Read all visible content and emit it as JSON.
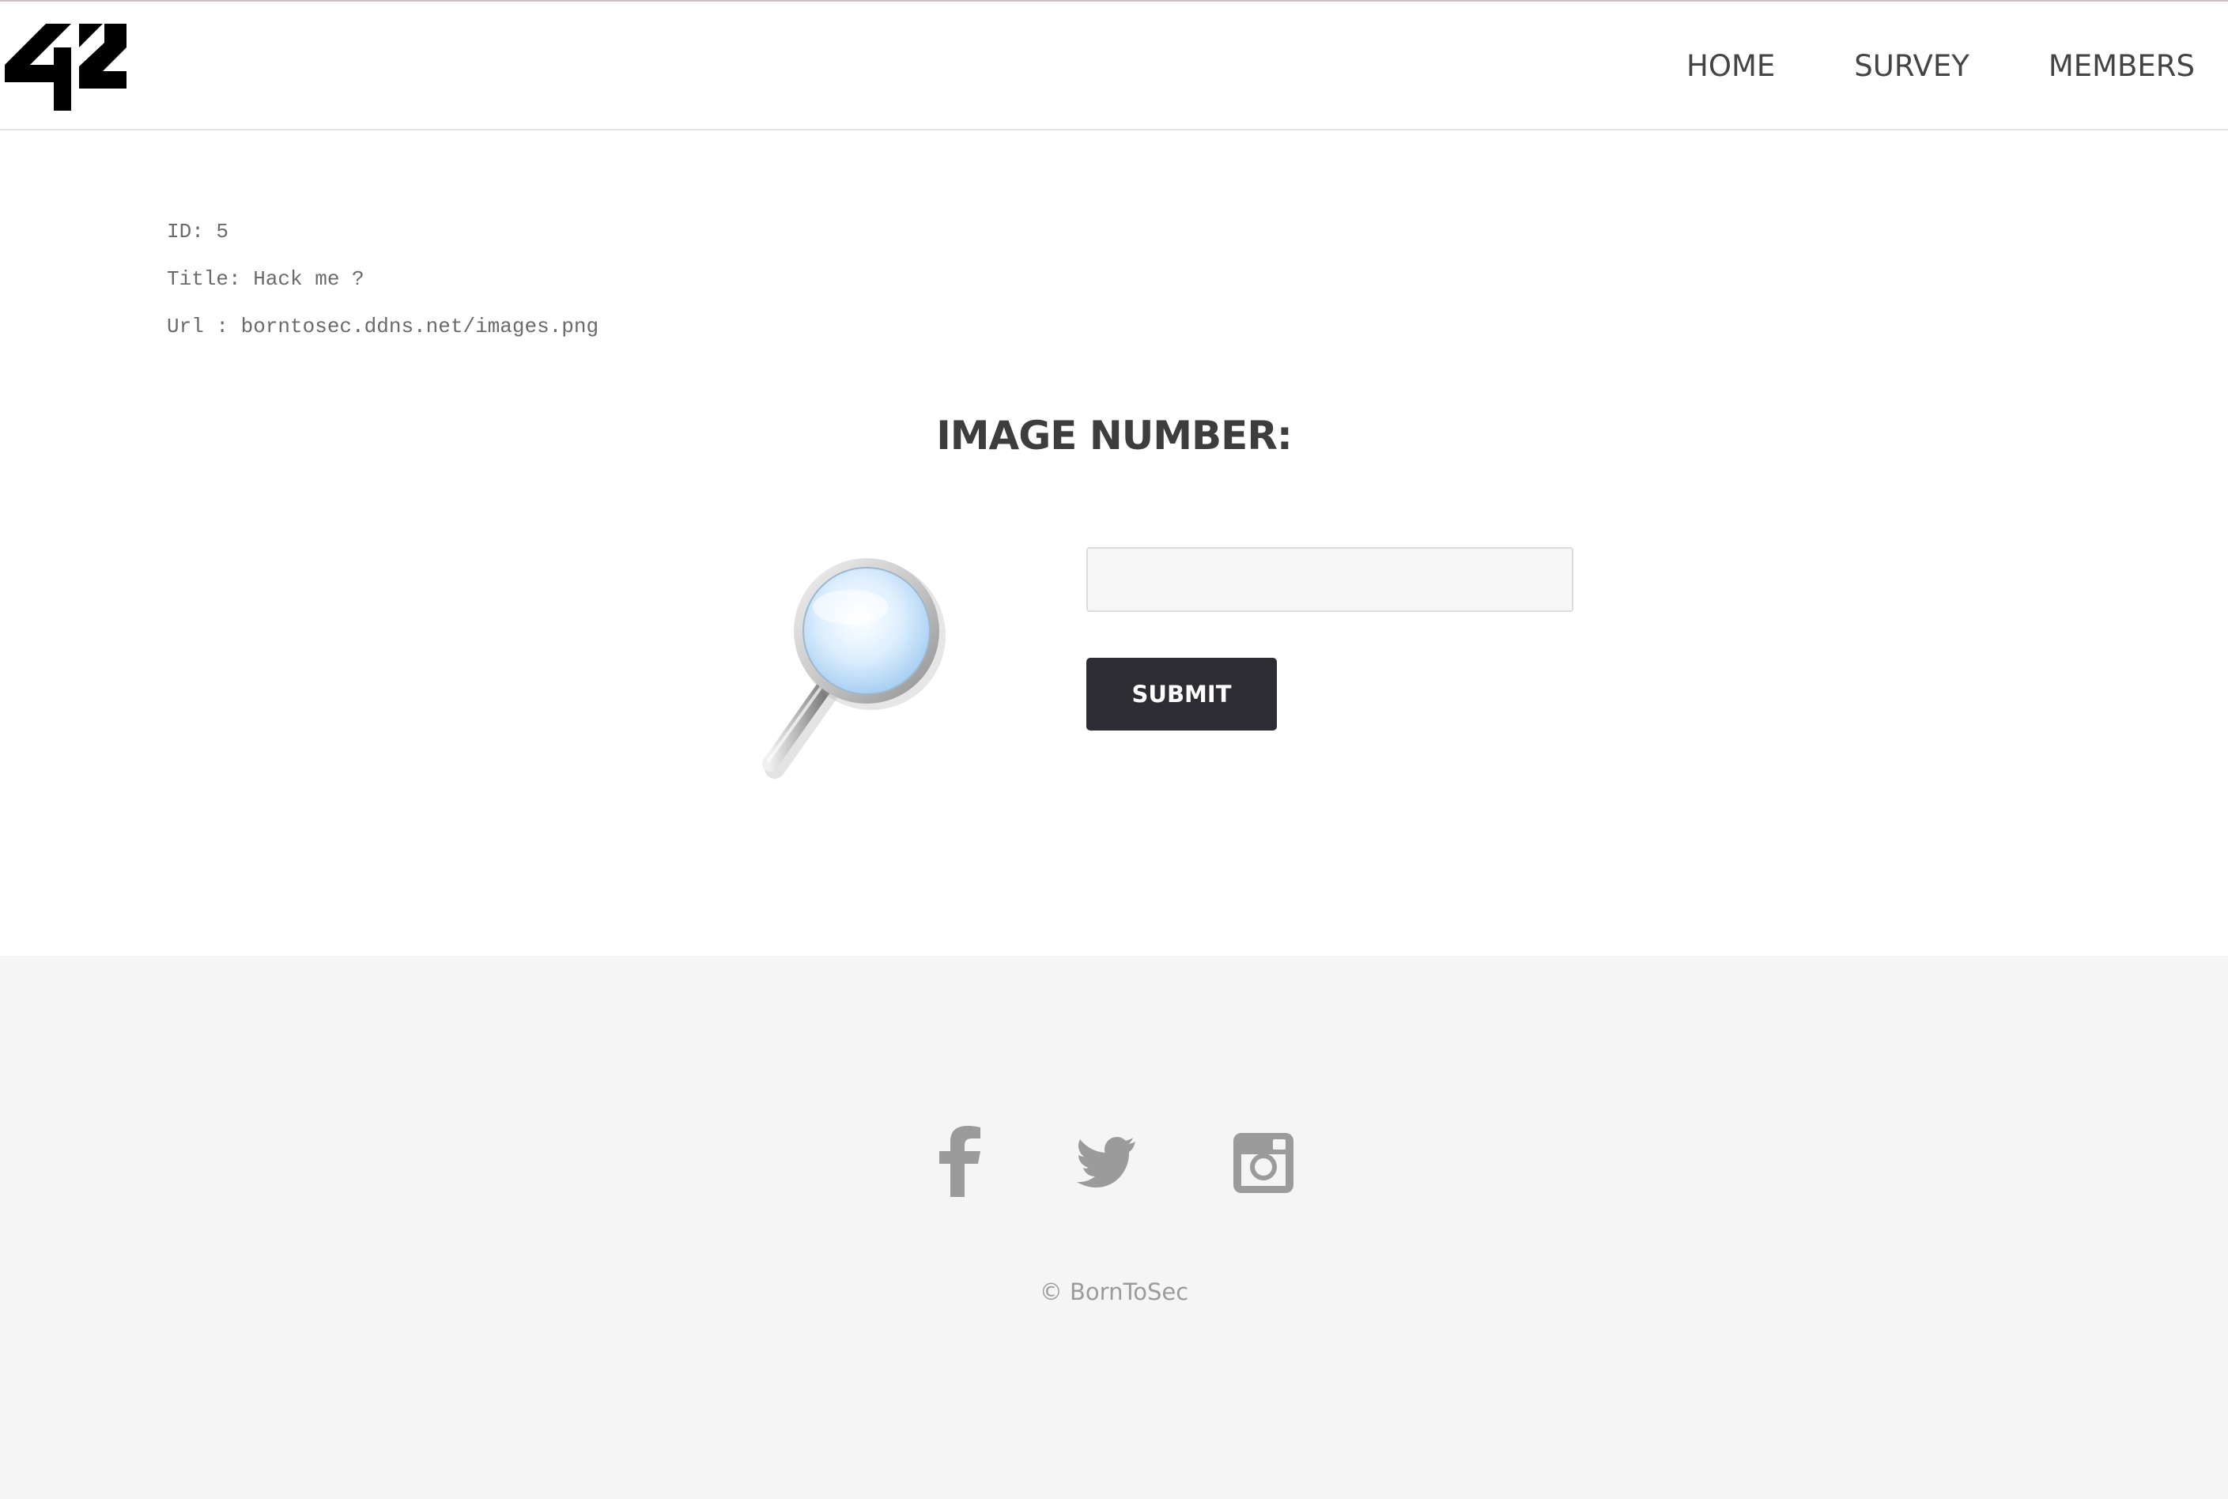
{
  "header": {
    "logo_text": "42",
    "nav": [
      {
        "label": "HOME"
      },
      {
        "label": "SURVEY"
      },
      {
        "label": "MEMBERS"
      }
    ]
  },
  "info": {
    "id_line": "ID: 5",
    "title_line": "Title: Hack me ?",
    "url_line": "Url : borntosec.ddns.net/images.png"
  },
  "search": {
    "heading": "IMAGE NUMBER:",
    "input_value": "",
    "input_placeholder": "",
    "submit_label": "SUBMIT"
  },
  "footer": {
    "social_icons": [
      "facebook-icon",
      "twitter-icon",
      "instagram-icon"
    ],
    "copyright": "© BornToSec"
  },
  "colors": {
    "submit_bg": "#2e2c33",
    "footer_bg": "#f5f5f5",
    "icon_gray": "#9b9b9b",
    "heading": "#3d3d3d"
  }
}
